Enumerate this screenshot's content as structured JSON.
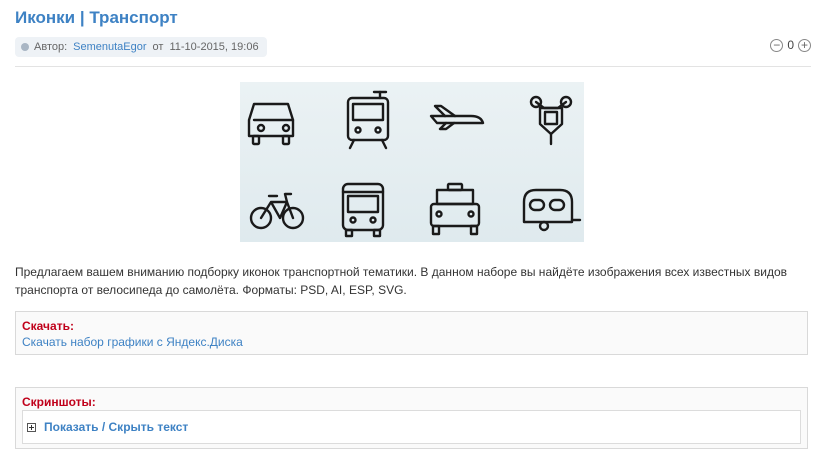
{
  "article": {
    "title": "Иконки | Транспорт",
    "meta": {
      "author_label": "Автор:",
      "author": "SemenutaEgor",
      "date_prefix": "от",
      "date": "11-10-2015, 19:06"
    },
    "rating": {
      "value": "0",
      "minus_icon": "minus-circle-icon",
      "plus_icon": "plus-circle-icon"
    },
    "preview_icons": [
      "car-icon",
      "tram-icon",
      "airplane-icon",
      "motorcycle-icon",
      "bicycle-icon",
      "bus-icon",
      "taxi-icon",
      "caravan-icon"
    ],
    "description": "Предлагаем вашем вниманию подборку иконок транспортной тематики. В данном наборе вы найдёте изображения всех известных видов транспорта от велосипеда до самолёта. Форматы: PSD, AI, ESP, SVG.",
    "download": {
      "title": "Скачать:",
      "link_text": "Скачать набор графики с Яндекс.Диска"
    },
    "screenshots": {
      "title": "Скриншоты:",
      "spoiler_label": "Показать / Скрыть текст"
    }
  },
  "colors": {
    "link": "#3e82c4",
    "accent_red": "#c0001a",
    "icon_stroke": "#1a1a1a"
  }
}
